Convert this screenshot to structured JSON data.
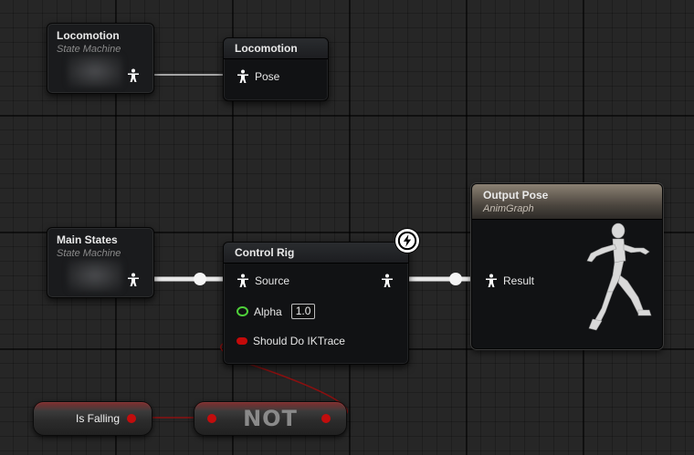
{
  "nodes": {
    "locomotion_sm": {
      "title": "Locomotion",
      "subtitle": "State Machine"
    },
    "locomotion_pose": {
      "title": "Locomotion",
      "pin_label": "Pose"
    },
    "main_states_sm": {
      "title": "Main States",
      "subtitle": "State Machine"
    },
    "control_rig": {
      "title": "Control Rig",
      "source_label": "Source",
      "alpha_label": "Alpha",
      "alpha_value": "1.0",
      "ik_label": "Should Do IKTrace"
    },
    "output_pose": {
      "title": "Output Pose",
      "subtitle": "AnimGraph",
      "result_label": "Result"
    },
    "is_falling": {
      "label": "Is Falling"
    },
    "not_node": {
      "label": "NOT"
    }
  },
  "icons": {
    "pose": "pose-pin-icon",
    "lightning": "lightning-icon",
    "mannequin": "running-mannequin-icon"
  },
  "colors": {
    "alpha_pin": "#4fd13a",
    "bool_pin": "#c40a0a",
    "output_header": "#8b8173"
  }
}
